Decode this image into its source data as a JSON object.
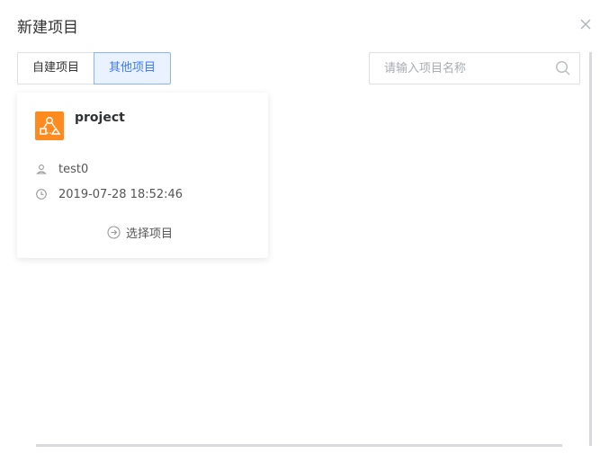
{
  "dialog": {
    "title": "新建项目"
  },
  "tabs": [
    {
      "label": "自建项目",
      "active": false
    },
    {
      "label": "其他项目",
      "active": true
    }
  ],
  "search": {
    "placeholder": "请输入项目名称",
    "value": ""
  },
  "project_card": {
    "name": "project",
    "owner": "test0",
    "created_at": "2019-07-28 18:52:46",
    "select_label": "选择项目",
    "logo_color": "#ff8a1f"
  },
  "colors": {
    "accent": "#3e7bfa",
    "accent_bg": "#eaf2ff",
    "border": "#dcdfe6"
  },
  "icons": {
    "close": "close-icon",
    "search": "search-icon",
    "project_logo": "project-logo-icon",
    "user": "user-icon",
    "clock": "clock-icon",
    "select": "arrow-circle-right-icon"
  }
}
